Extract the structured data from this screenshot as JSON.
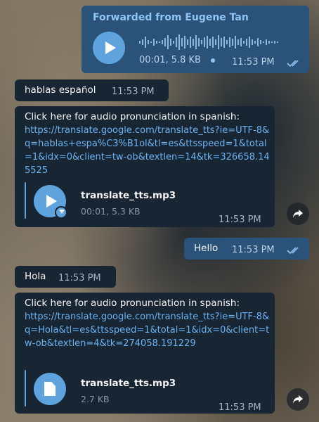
{
  "messages": {
    "voice": {
      "forwarded_from": "Forwarded from Eugene Tan",
      "duration_size": "00:01, 5.8 KB",
      "time": "11:53 PM",
      "icons": {
        "play": "play-icon",
        "status": "double-check-icon"
      }
    },
    "m1": {
      "text": "hablas español",
      "time": "11:53 PM"
    },
    "m2": {
      "intro": "Click here for audio pronunciation in spanish:",
      "url": "https://translate.google.com/translate_tts?ie=UTF-8&q=hablas+espa%C3%B1ol&tl=es&ttsspeed=1&total=1&idx=0&client=tw-ob&textlen=14&tk=326658.145525",
      "file_name": "translate_tts.mp3",
      "file_meta": "00:01, 5.3 KB",
      "time": "11:53 PM",
      "icons": {
        "play": "play-icon",
        "download": "download-icon",
        "share": "share-icon"
      }
    },
    "m3": {
      "text": "Hello",
      "time": "11:53 PM",
      "icons": {
        "status": "double-check-icon"
      }
    },
    "m4": {
      "text": "Hola",
      "time": "11:53 PM"
    },
    "m5": {
      "intro": "Click here for audio pronunciation in spanish:",
      "url": "https://translate.google.com/translate_tts?ie=UTF-8&q=Hola&tl=es&ttsspeed=1&total=1&idx=0&client=tw-ob&textlen=4&tk=274058.191229",
      "file_name": "translate_tts.mp3",
      "file_meta": "2.7 KB",
      "time": "11:53 PM",
      "icons": {
        "file": "file-icon",
        "share": "share-icon"
      }
    }
  },
  "colors": {
    "incoming_bubble": "#182533",
    "outgoing_bubble": "#2b5278",
    "link": "#6ab3f3",
    "accent": "#5fa3de"
  }
}
